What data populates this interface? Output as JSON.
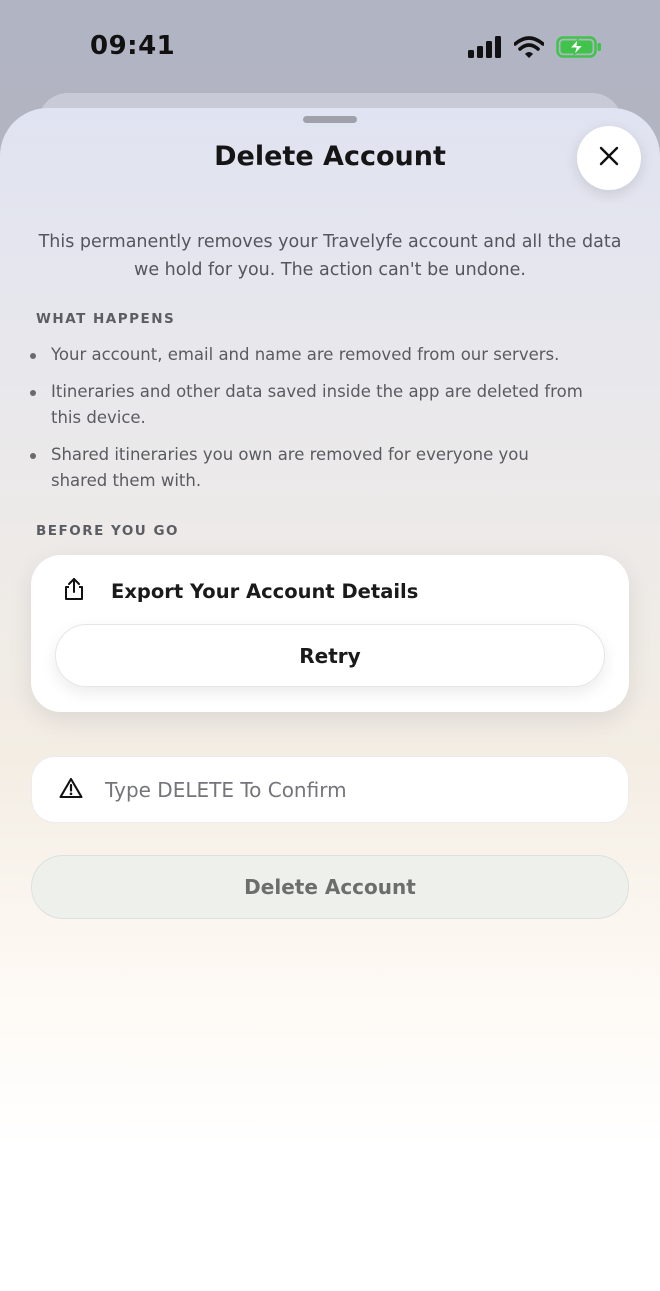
{
  "status_bar": {
    "time": "09:41",
    "icons": [
      "cellular-signal-icon",
      "wifi-icon",
      "battery-charging-icon"
    ],
    "battery_color": "#3fc34a"
  },
  "sheet": {
    "title": "Delete Account",
    "close_icon": "close-icon",
    "description": "This permanently removes your Travelyfe account and all the data we hold for you. The action can't be undone.",
    "what_happens": {
      "header": "WHAT HAPPENS",
      "items": [
        "Your account, email and name are removed from our servers.",
        "Itineraries and other data saved inside the app are deleted from this device.",
        "Shared itineraries you own are removed for everyone you shared them with."
      ]
    },
    "before_you_go": {
      "header": "BEFORE YOU GO",
      "export_icon": "share-icon",
      "export_label": "Export Your Account Details",
      "retry_label": "Retry"
    },
    "confirm": {
      "icon": "warning-icon",
      "placeholder": "Type DELETE To Confirm",
      "value": ""
    },
    "delete_button_label": "Delete Account"
  }
}
